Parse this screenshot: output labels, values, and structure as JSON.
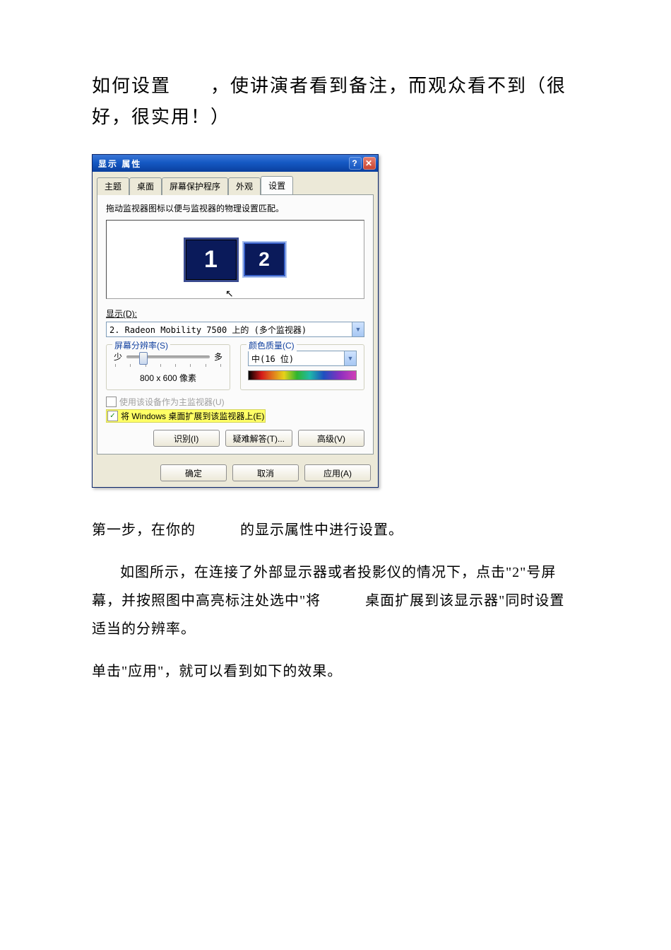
{
  "document": {
    "title": "如何设置　　，使讲演者看到备注，而观众看不到（很好，很实用！）",
    "para_step1": "第一步，在你的　　　的显示属性中进行设置。",
    "para_detail": "如图所示，在连接了外部显示器或者投影仪的情况下，点击\"2\"号屏幕，并按照图中高亮标注处选中\"将　　　桌面扩展到该显示器\"同时设置适当的分辨率。",
    "para_apply": "单击\"应用\"，就可以看到如下的效果。"
  },
  "dialog": {
    "title": "显示 属性",
    "tabs": {
      "theme": "主题",
      "desktop": "桌面",
      "screensaver": "屏幕保护程序",
      "appearance": "外观",
      "settings": "设置"
    },
    "dragHint": "拖动监视器图标以便与监视器的物理设置匹配。",
    "monitors": {
      "m1": "1",
      "m2": "2"
    },
    "display": {
      "label": "显示(D):",
      "value": "2. Radeon Mobility 7500 上的 (多个监视器)"
    },
    "resolution": {
      "legend": "屏幕分辨率(S)",
      "less": "少",
      "more": "多",
      "value": "800 x 600 像素"
    },
    "colorQuality": {
      "legend": "颜色质量(C)",
      "value": "中(16 位)"
    },
    "primaryCheckbox": "使用该设备作为主监视器(U)",
    "extendCheckbox": "将 Windows 桌面扩展到该监视器上(E)",
    "buttons": {
      "identify": "识别(I)",
      "troubleshoot": "疑难解答(T)...",
      "advanced": "高级(V)",
      "ok": "确定",
      "cancel": "取消",
      "apply": "应用(A)"
    }
  }
}
